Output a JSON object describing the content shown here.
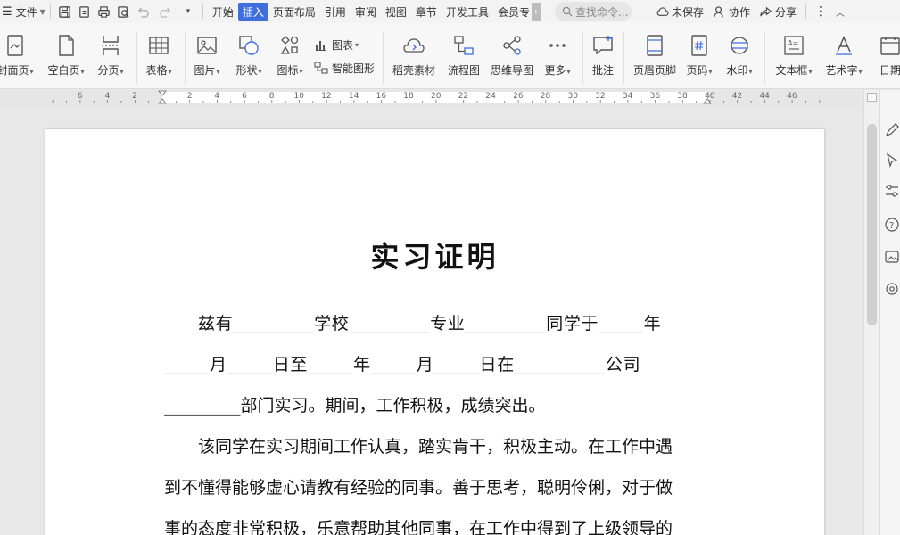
{
  "menubar": {
    "file_label": "文件",
    "tabs": [
      {
        "label": "开始",
        "active": false
      },
      {
        "label": "插入",
        "active": true
      },
      {
        "label": "页面布局",
        "active": false
      },
      {
        "label": "引用",
        "active": false
      },
      {
        "label": "审阅",
        "active": false
      },
      {
        "label": "视图",
        "active": false
      },
      {
        "label": "章节",
        "active": false
      },
      {
        "label": "开发工具",
        "active": false
      },
      {
        "label": "会员专",
        "active": false
      }
    ],
    "search_placeholder": "查找命令...",
    "unsaved_label": "未保存",
    "collab_label": "协作",
    "share_label": "分享"
  },
  "ribbon": {
    "cover": "封面页",
    "blank": "空白页",
    "pagebreak": "分页",
    "table": "表格",
    "picture": "图片",
    "shape": "形状",
    "icons": "图标",
    "chart": "图表",
    "smartart": "智能图形",
    "material": "稻壳素材",
    "flowchart": "流程图",
    "mindmap": "思维导图",
    "more": "更多",
    "comment": "批注",
    "header_footer": "页眉页脚",
    "page_number": "页码",
    "watermark": "水印",
    "textbox": "文本框",
    "wordart": "艺术字",
    "date": "日期"
  },
  "ruler": {
    "labels": [
      "6",
      "4",
      "2",
      "2",
      "4",
      "6",
      "8",
      "10",
      "12",
      "14",
      "16",
      "18",
      "20",
      "22",
      "24",
      "26",
      "28",
      "30",
      "32",
      "34",
      "36",
      "38",
      "40",
      "42",
      "44",
      "46"
    ]
  },
  "document": {
    "title": "实习证明",
    "line1": [
      "兹有_________学校_________专业_________同学于_____年"
    ],
    "line2": [
      "_____月_____日至_____年_____月_____日在__________公司"
    ],
    "line3": "_________部门实习。期间，工作积极，成绩突出。",
    "line4": "该同学在实习期间工作认真，踏实肯干，积极主动。在工作中遇",
    "line5": "到不懂得能够虚心请教有经验的同事。善于思考，聪明伶俐，对于做",
    "line6": "事的态度非常积极，乐意帮助其他同事，在工作中得到了上级领导的"
  },
  "colors": {
    "accent": "#3f6fdd",
    "page": "#ffffff",
    "canvas": "#e8e8e8"
  }
}
